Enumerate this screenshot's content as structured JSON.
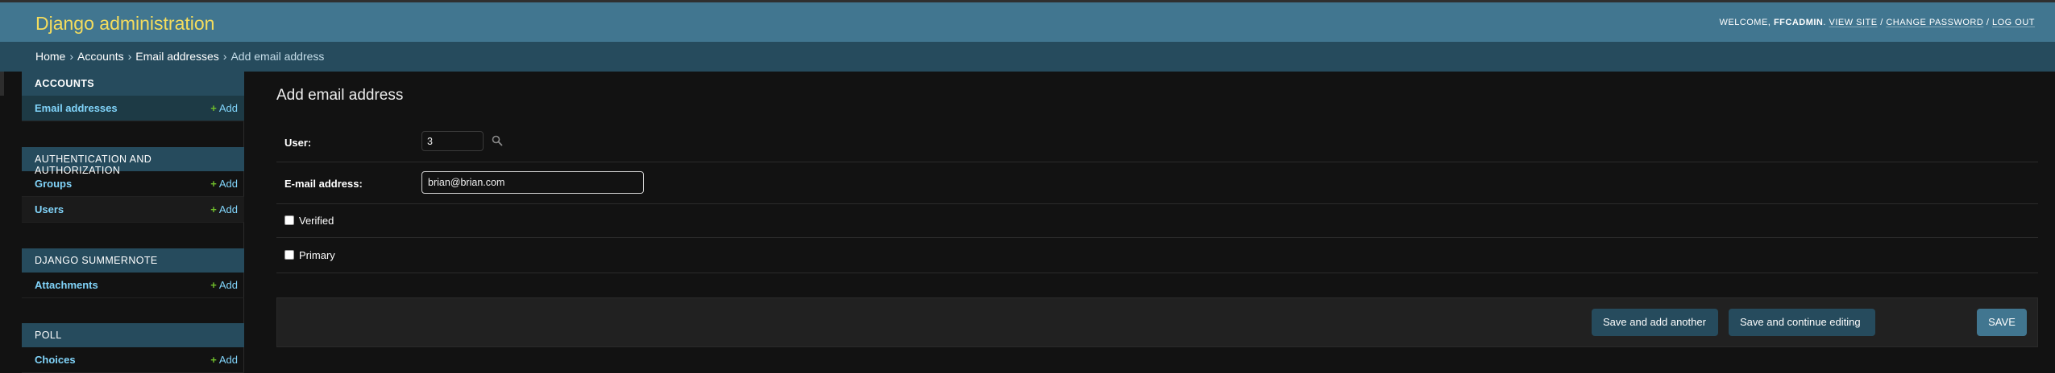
{
  "header": {
    "site_name": "Django administration",
    "welcome": "Welcome,",
    "username": "FFCADMIN",
    "view_site": "View site",
    "change_password": "Change password",
    "log_out": "Log out",
    "separator": "/"
  },
  "breadcrumbs": {
    "home": "Home",
    "accounts": "Accounts",
    "email_addresses": "Email addresses",
    "current": "Add email address",
    "sep": "›"
  },
  "sidebar": {
    "add_label": "Add",
    "modules": [
      {
        "caption": "Accounts",
        "models": [
          {
            "name": "Email addresses"
          }
        ]
      },
      {
        "caption": "Authentication and Authorization",
        "models": [
          {
            "name": "Groups"
          },
          {
            "name": "Users"
          }
        ]
      },
      {
        "caption": "Django Summernote",
        "models": [
          {
            "name": "Attachments"
          }
        ]
      },
      {
        "caption": "Poll",
        "models": [
          {
            "name": "Choices"
          }
        ]
      }
    ]
  },
  "form": {
    "title": "Add email address",
    "user_label": "User:",
    "user_value": "3",
    "email_label": "E-mail address:",
    "email_value": "brian@brian.com",
    "verified_label": "Verified",
    "verified_checked": false,
    "primary_label": "Primary",
    "primary_checked": false
  },
  "submit": {
    "save_add_another": "Save and add another",
    "save_continue": "Save and continue editing",
    "save": "SAVE"
  },
  "colors": {
    "header_bg": "#417690",
    "breadcrumb_bg": "#264b5d",
    "brand_text": "#f5dd5d",
    "link": "#81d4fa",
    "add_icon": "#70bf2b",
    "page_bg": "#121212"
  },
  "icons": {
    "add": "plus-icon",
    "lookup": "magnifier-icon"
  }
}
